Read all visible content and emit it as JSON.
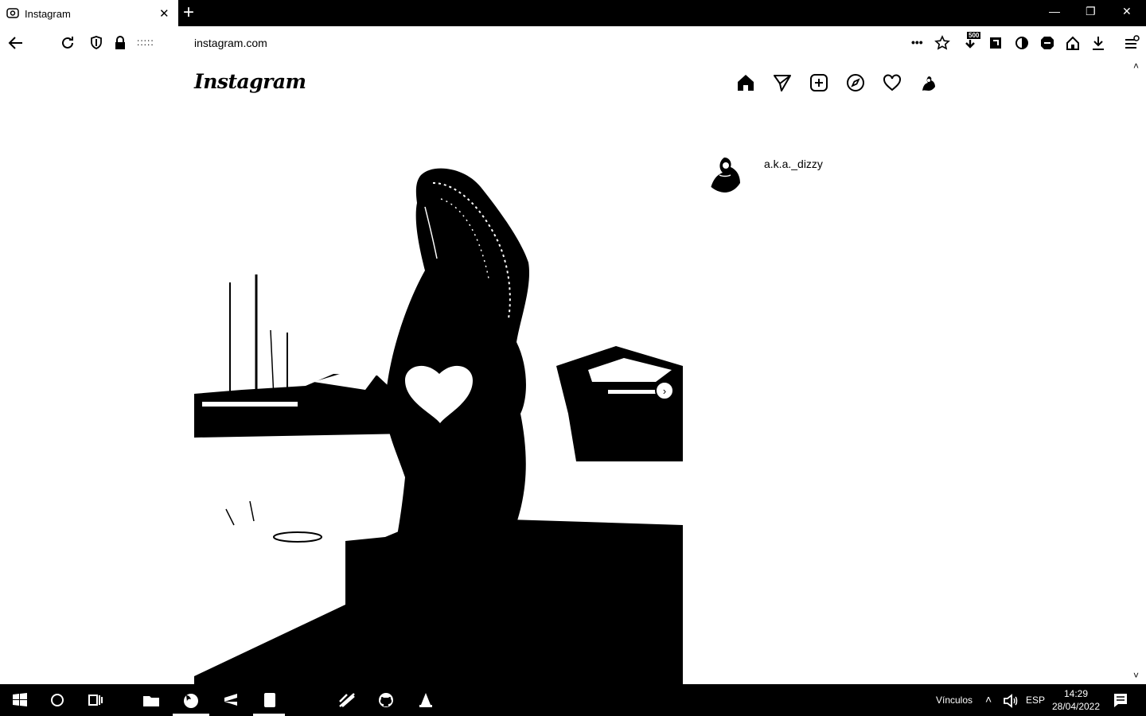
{
  "browser": {
    "tab_title": "Instagram",
    "new_tab_symbol": "+",
    "tab_close_symbol": "✕",
    "url_masked": ":::::",
    "url": "instagram.com",
    "menu_dots": "•••",
    "extension_badge": "500",
    "window_controls": [
      "—",
      "❐",
      "✕"
    ],
    "scroll_up": "˄",
    "scroll_down": "˅"
  },
  "instagram": {
    "logo": "Instagram",
    "nav_icons": [
      "home-icon",
      "direct-icon",
      "new-post-icon",
      "explore-icon",
      "activity-icon",
      "profile-avatar-icon"
    ],
    "post": {
      "username": "a.k.a._dizzy",
      "next_symbol": "›"
    }
  },
  "taskbar": {
    "links_label": "Vínculos",
    "language": "ESP",
    "time": "14:29",
    "date": "28/04/2022",
    "pinned_icons": [
      "windows-start-icon",
      "cortana-icon",
      "task-view-icon",
      "file-explorer-icon",
      "firefox-icon",
      "sublime-icon",
      "notepad-icon",
      "app-icon",
      "github-icon",
      "vlc-icon"
    ]
  },
  "colors": {
    "foreground": "#000000",
    "background": "#ffffff"
  }
}
